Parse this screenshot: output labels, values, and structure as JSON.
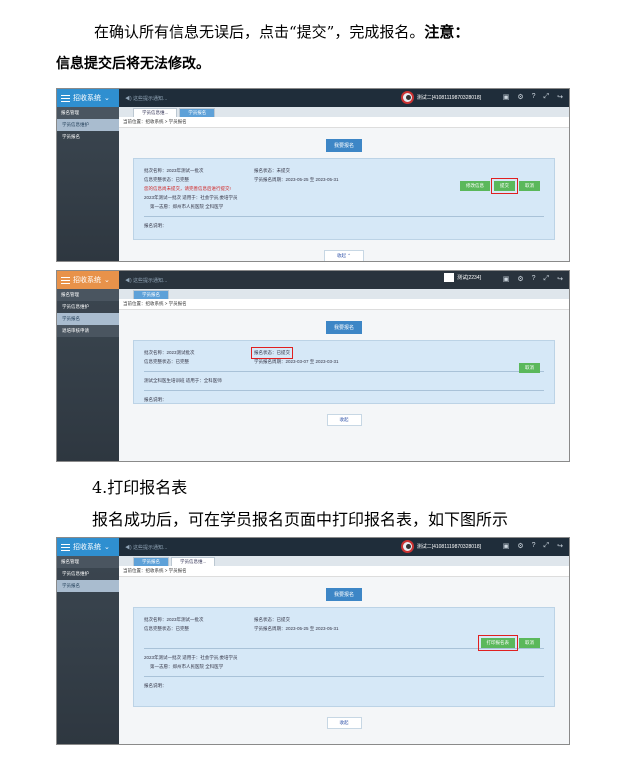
{
  "doc": {
    "p1_text": "在确认所有信息无误后，点击“提交”，完成报名。",
    "p1_bold": "注意：",
    "p1_line2": "信息提交后将无法修改。",
    "h4": "4.打印报名表",
    "p2": "报名成功后，可在学员报名页面中打印报名表，如下图所示"
  },
  "shot1": {
    "app": "招收系统",
    "notice": "◀) 这些提示通知...",
    "user": "测试二[41081119870328018]",
    "sidebar_head": "报名管理",
    "sidebar_items": [
      "学员信息维护",
      "学员报名"
    ],
    "tabs": [
      "学员信息维...",
      "学员报名"
    ],
    "crumb": "当前位置：招收系统 > 学员报名",
    "title_btn": "我要报名",
    "batch_label": "批次名称：2023年测试一批次",
    "status_label": "报名状态：未提交",
    "info_label": "信息完整状态：已完整",
    "period_label": "学员报名周期：2023-05-25 至 2023-05-31",
    "warning": "您的信息尚未提交，请完善信息后进行提交!",
    "btn_modify": "修改信息",
    "btn_submit": "提交",
    "btn_cancel": "取消",
    "batch_detail": "2023年测试一批次 适用于：社会学员,委培学员",
    "choice": "第一志愿：郑州市人民医院   全科医学",
    "remark": "报名说明：",
    "collapse": "收起 ⌃"
  },
  "shot2": {
    "app": "招收系统",
    "notice": "◀) 这些提示通知...",
    "user": "测试[2234]",
    "sidebar_head": "报名管理",
    "sidebar_items": [
      "学员信息维护",
      "学员报名",
      "退培审核申请"
    ],
    "tabs": [
      "学员报名"
    ],
    "crumb": "当前位置：招收系统 > 学员报名",
    "title_btn": "我要报名",
    "batch_label": "批次名称：2023测试批次",
    "status_label": "报名状态：已提交",
    "info_label": "信息完整状态：已完整",
    "period_label": "学员报名周期：2023-03-07 至 2023-03-31",
    "btn_cancel": "取消",
    "batch_detail": "测试全科医生培训班 适用于：全科医师",
    "remark": "报名说明：",
    "collapse": "收起"
  },
  "shot3": {
    "app": "招收系统",
    "notice": "◀) 这些提示通知...",
    "user": "测试二[41081119870328018]",
    "sidebar_head": "报名管理",
    "sidebar_items": [
      "学员信息维护",
      "学员报名"
    ],
    "tabs": [
      "学员报名",
      "学员信息维..."
    ],
    "crumb": "当前位置：招收系统 > 学员报名",
    "title_btn": "我要报名",
    "batch_label": "批次名称：2023年测试一批次",
    "status_label": "报名状态：已提交",
    "info_label": "信息完整状态：已完整",
    "period_label": "学员报名周期：2023-05-25 至 2023-05-31",
    "btn_print": "打印报名表",
    "btn_cancel": "取消",
    "batch_detail": "2023年测试一批次 适用于：社会学员,委培学员",
    "choice": "第一志愿：郑州市人民医院   全科医学",
    "remark": "报名说明：",
    "collapse": "收起"
  }
}
